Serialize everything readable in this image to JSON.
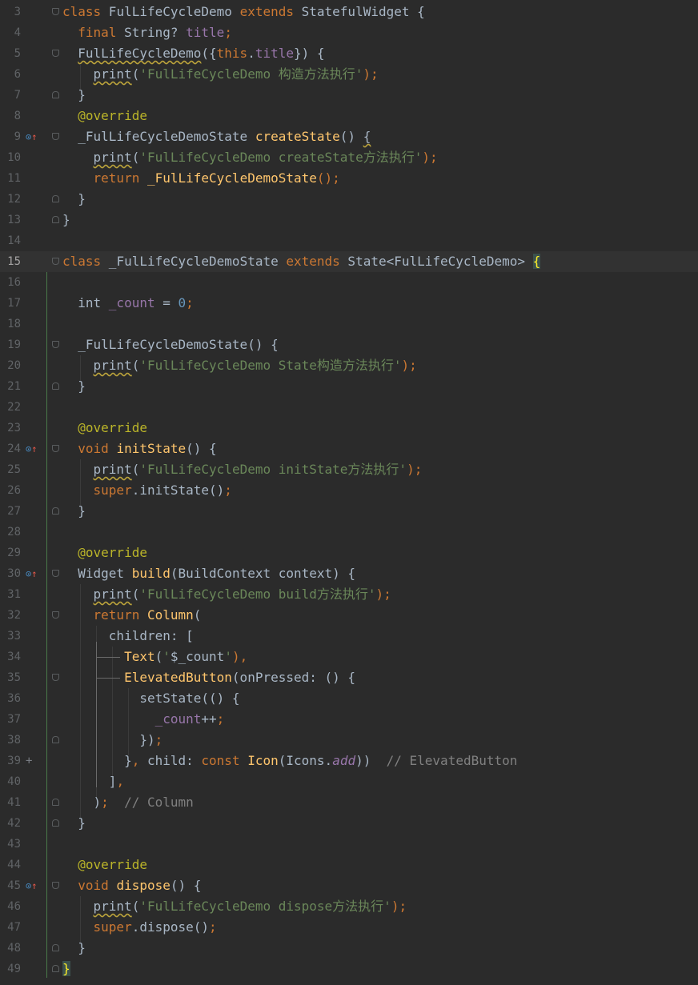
{
  "editor": {
    "current_line": "15",
    "lines": [
      {
        "num": "3",
        "tokens": [
          {
            "t": "class",
            "c": "kw"
          },
          {
            "t": " FulLifeCycleDemo ",
            "c": "plain"
          },
          {
            "t": "extends",
            "c": "kw"
          },
          {
            "t": " StatefulWidget {",
            "c": "plain"
          }
        ]
      },
      {
        "num": "4",
        "tokens": [
          {
            "t": "  ",
            "c": "plain"
          },
          {
            "t": "final",
            "c": "kw"
          },
          {
            "t": " String? ",
            "c": "plain"
          },
          {
            "t": "title",
            "c": "field"
          },
          {
            "t": ";",
            "c": "kw"
          }
        ]
      },
      {
        "num": "5",
        "tokens": [
          {
            "t": "  ",
            "c": "plain"
          },
          {
            "t": "FulLifeCycleDemo",
            "c": "warn"
          },
          {
            "t": "({",
            "c": "plain"
          },
          {
            "t": "this",
            "c": "kw"
          },
          {
            "t": ".",
            "c": "plain"
          },
          {
            "t": "title",
            "c": "field"
          },
          {
            "t": "}) {",
            "c": "plain"
          }
        ]
      },
      {
        "num": "6",
        "tokens": [
          {
            "t": "    ",
            "c": "plain"
          },
          {
            "t": "print",
            "c": "warn"
          },
          {
            "t": "(",
            "c": "plain"
          },
          {
            "t": "'FulLifeCycleDemo 构造方法执行'",
            "c": "str"
          },
          {
            "t": ");",
            "c": "kw"
          }
        ]
      },
      {
        "num": "7",
        "tokens": [
          {
            "t": "  }",
            "c": "plain"
          }
        ]
      },
      {
        "num": "8",
        "tokens": [
          {
            "t": "  ",
            "c": "plain"
          },
          {
            "t": "@override",
            "c": "ann"
          }
        ]
      },
      {
        "num": "9",
        "tokens": [
          {
            "t": "  _FulLifeCycleDemoState ",
            "c": "plain"
          },
          {
            "t": "createState",
            "c": "fn"
          },
          {
            "t": "() ",
            "c": "plain"
          },
          {
            "t": "{",
            "c": "warn"
          }
        ]
      },
      {
        "num": "10",
        "tokens": [
          {
            "t": "    ",
            "c": "plain"
          },
          {
            "t": "print",
            "c": "warn"
          },
          {
            "t": "(",
            "c": "plain"
          },
          {
            "t": "'FulLifeCycleDemo createState方法执行'",
            "c": "str"
          },
          {
            "t": ");",
            "c": "kw"
          }
        ]
      },
      {
        "num": "11",
        "tokens": [
          {
            "t": "    ",
            "c": "plain"
          },
          {
            "t": "return",
            "c": "kw"
          },
          {
            "t": " ",
            "c": "plain"
          },
          {
            "t": "_FulLifeCycleDemoState",
            "c": "fn"
          },
          {
            "t": "();",
            "c": "kw"
          }
        ]
      },
      {
        "num": "12",
        "tokens": [
          {
            "t": "  }",
            "c": "plain"
          }
        ]
      },
      {
        "num": "13",
        "tokens": [
          {
            "t": "}",
            "c": "plain"
          }
        ]
      },
      {
        "num": "14",
        "tokens": []
      },
      {
        "num": "15",
        "tokens": [
          {
            "t": "class",
            "c": "kw"
          },
          {
            "t": " _FulLifeCycleDemoState ",
            "c": "plain"
          },
          {
            "t": "extends",
            "c": "kw"
          },
          {
            "t": " State<FulLifeCycleDemo> ",
            "c": "plain"
          },
          {
            "t": "{",
            "c": "brace"
          }
        ]
      },
      {
        "num": "16",
        "tokens": []
      },
      {
        "num": "17",
        "tokens": [
          {
            "t": "  int ",
            "c": "plain"
          },
          {
            "t": "_count",
            "c": "field"
          },
          {
            "t": " = ",
            "c": "plain"
          },
          {
            "t": "0",
            "c": "num"
          },
          {
            "t": ";",
            "c": "kw"
          }
        ]
      },
      {
        "num": "18",
        "tokens": []
      },
      {
        "num": "19",
        "tokens": [
          {
            "t": "  _FulLifeCycleDemoState() {",
            "c": "plain"
          }
        ]
      },
      {
        "num": "20",
        "tokens": [
          {
            "t": "    ",
            "c": "plain"
          },
          {
            "t": "print",
            "c": "warn"
          },
          {
            "t": "(",
            "c": "plain"
          },
          {
            "t": "'FulLifeCycleDemo State构造方法执行'",
            "c": "str"
          },
          {
            "t": ");",
            "c": "kw"
          }
        ]
      },
      {
        "num": "21",
        "tokens": [
          {
            "t": "  }",
            "c": "plain"
          }
        ]
      },
      {
        "num": "22",
        "tokens": []
      },
      {
        "num": "23",
        "tokens": [
          {
            "t": "  ",
            "c": "plain"
          },
          {
            "t": "@override",
            "c": "ann"
          }
        ]
      },
      {
        "num": "24",
        "tokens": [
          {
            "t": "  ",
            "c": "plain"
          },
          {
            "t": "void",
            "c": "kw"
          },
          {
            "t": " ",
            "c": "plain"
          },
          {
            "t": "initState",
            "c": "fn"
          },
          {
            "t": "() {",
            "c": "plain"
          }
        ]
      },
      {
        "num": "25",
        "tokens": [
          {
            "t": "    ",
            "c": "plain"
          },
          {
            "t": "print",
            "c": "warn"
          },
          {
            "t": "(",
            "c": "plain"
          },
          {
            "t": "'FulLifeCycleDemo initState方法执行'",
            "c": "str"
          },
          {
            "t": ");",
            "c": "kw"
          }
        ]
      },
      {
        "num": "26",
        "tokens": [
          {
            "t": "    ",
            "c": "plain"
          },
          {
            "t": "super",
            "c": "kw"
          },
          {
            "t": ".initState()",
            "c": "plain"
          },
          {
            "t": ";",
            "c": "kw"
          }
        ]
      },
      {
        "num": "27",
        "tokens": [
          {
            "t": "  }",
            "c": "plain"
          }
        ]
      },
      {
        "num": "28",
        "tokens": []
      },
      {
        "num": "29",
        "tokens": [
          {
            "t": "  ",
            "c": "plain"
          },
          {
            "t": "@override",
            "c": "ann"
          }
        ]
      },
      {
        "num": "30",
        "tokens": [
          {
            "t": "  Widget ",
            "c": "plain"
          },
          {
            "t": "build",
            "c": "fn"
          },
          {
            "t": "(BuildContext context) {",
            "c": "plain"
          }
        ]
      },
      {
        "num": "31",
        "tokens": [
          {
            "t": "    ",
            "c": "plain"
          },
          {
            "t": "print",
            "c": "warn"
          },
          {
            "t": "(",
            "c": "plain"
          },
          {
            "t": "'FulLifeCycleDemo build方法执行'",
            "c": "str"
          },
          {
            "t": ");",
            "c": "kw"
          }
        ]
      },
      {
        "num": "32",
        "tokens": [
          {
            "t": "    ",
            "c": "plain"
          },
          {
            "t": "return",
            "c": "kw"
          },
          {
            "t": " ",
            "c": "plain"
          },
          {
            "t": "Column",
            "c": "fn"
          },
          {
            "t": "(",
            "c": "plain"
          }
        ]
      },
      {
        "num": "33",
        "tokens": [
          {
            "t": "      children: [",
            "c": "plain"
          }
        ]
      },
      {
        "num": "34",
        "tokens": [
          {
            "t": "        ",
            "c": "plain"
          },
          {
            "t": "Text",
            "c": "fn"
          },
          {
            "t": "(",
            "c": "plain"
          },
          {
            "t": "'",
            "c": "str"
          },
          {
            "t": "$_count",
            "c": "plain"
          },
          {
            "t": "'",
            "c": "str"
          },
          {
            "t": "),",
            "c": "kw"
          }
        ]
      },
      {
        "num": "35",
        "tokens": [
          {
            "t": "        ",
            "c": "plain"
          },
          {
            "t": "ElevatedButton",
            "c": "fn"
          },
          {
            "t": "(onPressed: () {",
            "c": "plain"
          }
        ]
      },
      {
        "num": "36",
        "tokens": [
          {
            "t": "          setState(() {",
            "c": "plain"
          }
        ]
      },
      {
        "num": "37",
        "tokens": [
          {
            "t": "            ",
            "c": "plain"
          },
          {
            "t": "_count",
            "c": "field"
          },
          {
            "t": "++",
            "c": "plain"
          },
          {
            "t": ";",
            "c": "kw"
          }
        ]
      },
      {
        "num": "38",
        "tokens": [
          {
            "t": "          })",
            "c": "plain"
          },
          {
            "t": ";",
            "c": "kw"
          }
        ]
      },
      {
        "num": "39",
        "tokens": [
          {
            "t": "        }",
            "c": "plain"
          },
          {
            "t": ", ",
            "c": "kw"
          },
          {
            "t": "child: ",
            "c": "plain"
          },
          {
            "t": "const",
            "c": "kw"
          },
          {
            "t": " ",
            "c": "plain"
          },
          {
            "t": "Icon",
            "c": "fn"
          },
          {
            "t": "(Icons.",
            "c": "plain"
          },
          {
            "t": "add",
            "c": "fieldi"
          },
          {
            "t": "))  ",
            "c": "plain"
          },
          {
            "t": "// ElevatedButton",
            "c": "cmt"
          }
        ]
      },
      {
        "num": "40",
        "tokens": [
          {
            "t": "      ]",
            "c": "plain"
          },
          {
            "t": ",",
            "c": "kw"
          }
        ]
      },
      {
        "num": "41",
        "tokens": [
          {
            "t": "    )",
            "c": "plain"
          },
          {
            "t": ";",
            "c": "kw"
          },
          {
            "t": "  ",
            "c": "plain"
          },
          {
            "t": "// Column",
            "c": "cmt"
          }
        ]
      },
      {
        "num": "42",
        "tokens": [
          {
            "t": "  }",
            "c": "plain"
          }
        ]
      },
      {
        "num": "43",
        "tokens": []
      },
      {
        "num": "44",
        "tokens": [
          {
            "t": "  ",
            "c": "plain"
          },
          {
            "t": "@override",
            "c": "ann"
          }
        ]
      },
      {
        "num": "45",
        "tokens": [
          {
            "t": "  ",
            "c": "plain"
          },
          {
            "t": "void",
            "c": "kw"
          },
          {
            "t": " ",
            "c": "plain"
          },
          {
            "t": "dispose",
            "c": "fn"
          },
          {
            "t": "() {",
            "c": "plain"
          }
        ]
      },
      {
        "num": "46",
        "tokens": [
          {
            "t": "    ",
            "c": "plain"
          },
          {
            "t": "print",
            "c": "warn"
          },
          {
            "t": "(",
            "c": "plain"
          },
          {
            "t": "'FulLifeCycleDemo dispose方法执行'",
            "c": "str"
          },
          {
            "t": ");",
            "c": "kw"
          }
        ]
      },
      {
        "num": "47",
        "tokens": [
          {
            "t": "    ",
            "c": "plain"
          },
          {
            "t": "super",
            "c": "kw"
          },
          {
            "t": ".dispose()",
            "c": "plain"
          },
          {
            "t": ";",
            "c": "kw"
          }
        ]
      },
      {
        "num": "48",
        "tokens": [
          {
            "t": "  }",
            "c": "plain"
          }
        ]
      },
      {
        "num": "49",
        "tokens": [
          {
            "t": "}",
            "c": "brace"
          }
        ]
      }
    ]
  },
  "gutter": {
    "override_lines": [
      "9",
      "24",
      "30",
      "45"
    ],
    "override_icon": "override-method-icon",
    "plus_lines": [
      "39"
    ],
    "plus_icon": "fold-plus-icon"
  },
  "colors": {
    "background": "#2b2b2b",
    "keyword": "#cc7832",
    "function": "#ffc66d",
    "string": "#6a8759",
    "number": "#6897bb",
    "field": "#9876aa",
    "annotation": "#bbb529",
    "comment": "#808080",
    "text": "#a9b7c6"
  }
}
